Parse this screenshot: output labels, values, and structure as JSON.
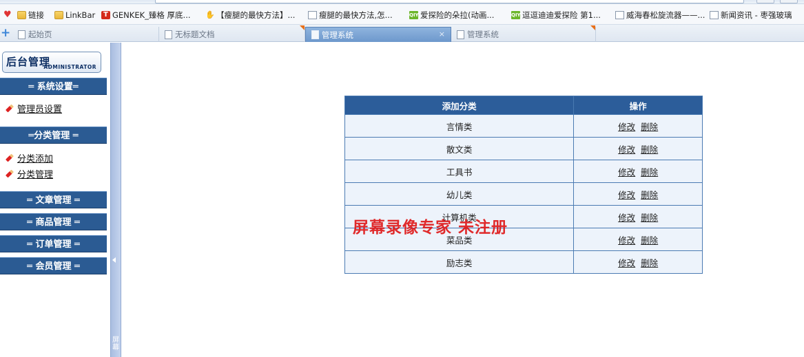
{
  "browser": {
    "bookmarks": [
      {
        "icon": "heart-icon",
        "label": ""
      },
      {
        "icon": "folder-icon",
        "label": "链接"
      },
      {
        "icon": "folder-icon",
        "label": "LinkBar"
      },
      {
        "icon": "t-logo-icon",
        "label": "GENKEK_臻格 厚底..."
      },
      {
        "icon": "hand-icon",
        "label": "【瘦腿的最快方法】..."
      },
      {
        "icon": "doc-icon",
        "label": "瘦腿的最快方法,怎..."
      },
      {
        "icon": "qiyi-icon",
        "label": "爱探险的朵拉(动画..."
      },
      {
        "icon": "qiyi-icon",
        "label": "逗逗迪迪爱探险 第1..."
      },
      {
        "icon": "doc-icon",
        "label": "威海春松旋流器——..."
      },
      {
        "icon": "doc-icon",
        "label": "新闻资讯 - 枣强玻璃"
      }
    ],
    "tabs": [
      {
        "label": "起始页",
        "active": false
      },
      {
        "label": "无标题文档",
        "active": false
      },
      {
        "label": "管理系统",
        "active": true
      },
      {
        "label": "管理系统",
        "active": false
      }
    ],
    "tab_close": "×",
    "new_tab": "+"
  },
  "sidebar": {
    "logo_cn": "后台管理",
    "logo_en": "ADMINISTRATOR",
    "sections": {
      "system": "═ 系统设置═",
      "category": "═分类管理 ═",
      "article": "═ 文章管理 ═",
      "product": "═ 商品管理 ═",
      "order": "═ 订单管理 ═",
      "member": "═ 会员管理 ═"
    },
    "items": {
      "admin_settings": "管理员设置",
      "category_add": "分类添加",
      "category_manage": "分类管理"
    }
  },
  "splitter": {
    "vertical_text": "屏幕"
  },
  "table": {
    "headers": [
      "添加分类",
      "操作"
    ],
    "rows": [
      {
        "name": "言情类",
        "edit": "修改",
        "delete": "删除"
      },
      {
        "name": "散文类",
        "edit": "修改",
        "delete": "删除"
      },
      {
        "name": "工具书",
        "edit": "修改",
        "delete": "删除"
      },
      {
        "name": "幼儿类",
        "edit": "修改",
        "delete": "删除"
      },
      {
        "name": "计算机类",
        "edit": "修改",
        "delete": "删除"
      },
      {
        "name": "菜品类",
        "edit": "修改",
        "delete": "删除"
      },
      {
        "name": "励志类",
        "edit": "修改",
        "delete": "删除"
      }
    ]
  },
  "watermark": "屏幕录像专家 未注册",
  "colors": {
    "nav_blue": "#2b5b93",
    "table_header": "#2c5d9a",
    "row_bg": "#edf3fb",
    "watermark_red": "#de1414"
  }
}
